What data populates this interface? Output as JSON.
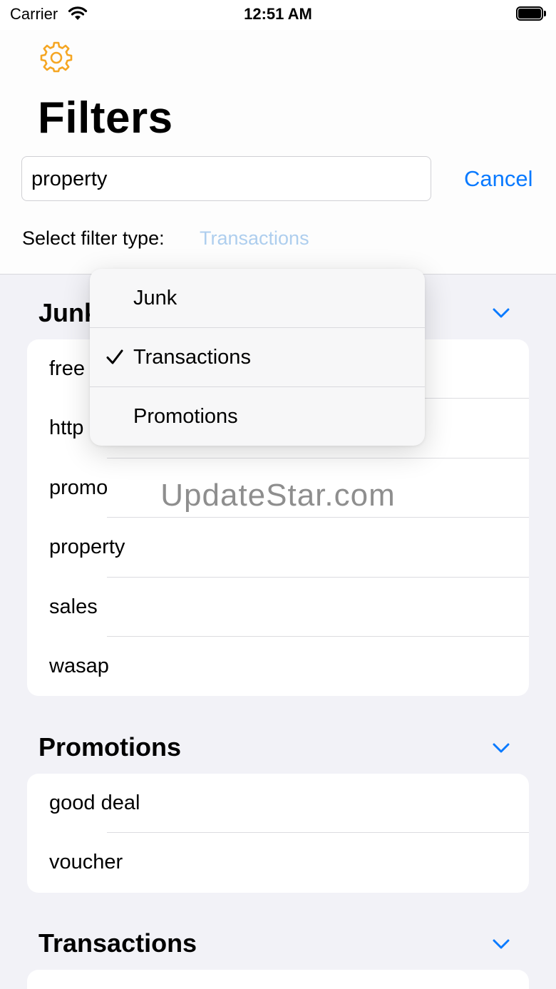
{
  "status_bar": {
    "carrier": "Carrier",
    "time": "12:51 AM"
  },
  "header": {
    "title": "Filters",
    "search_value": "property",
    "cancel_label": "Cancel",
    "filter_type_label": "Select filter type:",
    "filter_type_value": "Transactions"
  },
  "dropdown": {
    "options": [
      {
        "label": "Junk",
        "selected": false
      },
      {
        "label": "Transactions",
        "selected": true
      },
      {
        "label": "Promotions",
        "selected": false
      }
    ]
  },
  "sections": [
    {
      "title": "Junk",
      "items": [
        "free",
        "http",
        "promo",
        "property",
        "sales",
        "wasap"
      ]
    },
    {
      "title": "Promotions",
      "items": [
        "good deal",
        "voucher"
      ]
    },
    {
      "title": "Transactions",
      "items": []
    }
  ],
  "watermark": "UpdateStar.com",
  "colors": {
    "accent": "#0a7aff",
    "gear": "#f5a623",
    "background": "#f2f2f7"
  },
  "icons": {
    "settings": "gear-icon",
    "collapse": "chevron-down-icon",
    "selected": "checkmark-icon",
    "wifi": "wifi-icon",
    "battery": "battery-icon"
  }
}
